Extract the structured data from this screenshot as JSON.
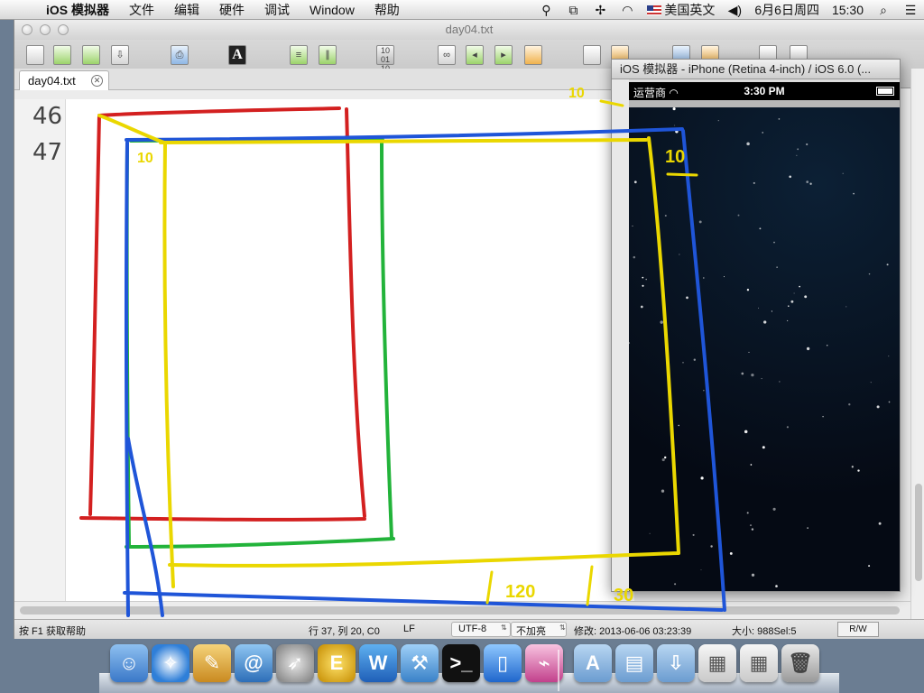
{
  "menubar": {
    "app_name": "iOS 模拟器",
    "items": [
      "文件",
      "编辑",
      "硬件",
      "调试",
      "Window",
      "帮助"
    ],
    "input_source": "美国英文",
    "date": "6月6日周四",
    "time": "15:30"
  },
  "editor": {
    "window_title": "day04.txt",
    "tab_label": "day04.txt",
    "line_numbers": [
      "46",
      "47"
    ],
    "status": {
      "help": "按 F1 获取帮助",
      "position": "行 37, 列 20, C0",
      "line_ending": "LF",
      "encoding": "UTF-8",
      "highlight": "不加亮",
      "modified": "修改: 2013-06-06 03:23:39",
      "size": "大小: 988Sel:5",
      "mode": "R/W"
    },
    "toolbar_icons": [
      "new-file-icon",
      "open-folder-icon",
      "reopen-icon",
      "save-icon",
      "print-icon",
      "font-icon",
      "list-icon",
      "columns-icon",
      "binary-icon",
      "find-icon",
      "find-prev-icon",
      "find-next-icon",
      "replace-icon",
      "word-wrap-icon",
      "ruler-icon",
      "browse-icon",
      "tools-icon",
      "window-icon",
      "split-icon"
    ]
  },
  "simulator": {
    "title": "iOS 模拟器 - iPhone (Retina 4-inch) / iOS 6.0 (...",
    "carrier": "运营商",
    "time": "3:30 PM"
  },
  "annotations": {
    "labels": [
      "10",
      "10",
      "10",
      "120",
      "30"
    ],
    "colors": {
      "red": "#d32020",
      "green": "#22b33a",
      "blue": "#1f55d8",
      "yellow": "#ead700"
    }
  },
  "dock": {
    "items": [
      "finder-icon",
      "safari-icon",
      "xcode-installer-icon",
      "address-book-icon",
      "launchpad-icon",
      "editplus-icon",
      "word-icon",
      "xcode-icon",
      "terminal-icon",
      "ios-simulator-icon",
      "instruments-icon",
      "applications-folder-icon",
      "documents-folder-icon",
      "downloads-folder-icon",
      "screenshots-stack-icon",
      "trash-icon"
    ]
  }
}
